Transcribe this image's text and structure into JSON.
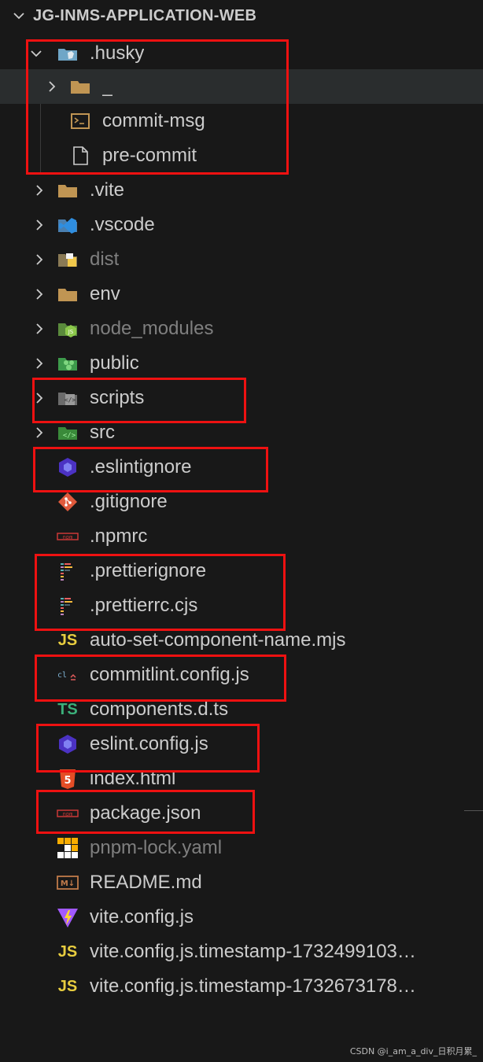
{
  "explorer": {
    "title": "JG-INMS-APPLICATION-WEB",
    "items": [
      {
        "label": ".husky",
        "kind": "folder-open",
        "icon": "husky-folder-icon"
      },
      {
        "label": "_",
        "kind": "folder-collapsed",
        "icon": "folder-icon"
      },
      {
        "label": "commit-msg",
        "kind": "file",
        "icon": "terminal-file-icon"
      },
      {
        "label": "pre-commit",
        "kind": "file",
        "icon": "file-icon"
      },
      {
        "label": ".vite",
        "kind": "folder-collapsed",
        "icon": "folder-icon"
      },
      {
        "label": ".vscode",
        "kind": "folder-collapsed",
        "icon": "vscode-folder-icon"
      },
      {
        "label": "dist",
        "kind": "folder-collapsed",
        "icon": "dist-folder-icon"
      },
      {
        "label": "env",
        "kind": "folder-collapsed",
        "icon": "folder-icon"
      },
      {
        "label": "node_modules",
        "kind": "folder-collapsed",
        "icon": "node-folder-icon"
      },
      {
        "label": "public",
        "kind": "folder-collapsed",
        "icon": "public-folder-icon"
      },
      {
        "label": "scripts",
        "kind": "folder-collapsed",
        "icon": "scripts-folder-icon"
      },
      {
        "label": "src",
        "kind": "folder-collapsed",
        "icon": "src-folder-icon"
      },
      {
        "label": ".eslintignore",
        "kind": "file",
        "icon": "eslint-icon"
      },
      {
        "label": ".gitignore",
        "kind": "file",
        "icon": "git-icon"
      },
      {
        "label": ".npmrc",
        "kind": "file",
        "icon": "npm-icon"
      },
      {
        "label": ".prettierignore",
        "kind": "file",
        "icon": "prettier-icon"
      },
      {
        "label": ".prettierrc.cjs",
        "kind": "file",
        "icon": "prettier-icon"
      },
      {
        "label": "auto-set-component-name.mjs",
        "kind": "file",
        "icon": "js-icon"
      },
      {
        "label": "commitlint.config.js",
        "kind": "file",
        "icon": "commitlint-icon"
      },
      {
        "label": "components.d.ts",
        "kind": "file",
        "icon": "ts-icon"
      },
      {
        "label": "eslint.config.js",
        "kind": "file",
        "icon": "eslint-icon"
      },
      {
        "label": "index.html",
        "kind": "file",
        "icon": "html-icon"
      },
      {
        "label": "package.json",
        "kind": "file",
        "icon": "npm-icon"
      },
      {
        "label": "pnpm-lock.yaml",
        "kind": "file",
        "icon": "pnpm-icon"
      },
      {
        "label": "README.md",
        "kind": "file",
        "icon": "markdown-icon"
      },
      {
        "label": "vite.config.js",
        "kind": "file",
        "icon": "vite-icon"
      },
      {
        "label": "vite.config.js.timestamp-1732499103…",
        "kind": "file",
        "icon": "js-icon"
      },
      {
        "label": "vite.config.js.timestamp-1732673178…",
        "kind": "file",
        "icon": "js-icon"
      }
    ]
  },
  "icon_glyphs": {
    "js": "JS",
    "ts": "TS",
    "html": "5",
    "markdown": "M↓",
    "npm": "npm",
    "commitlint": "cl"
  },
  "watermark": "CSDN @i_am_a_div_日积月累_",
  "colors": {
    "background": "#181818",
    "text": "#cccccc",
    "dim_text": "#7f7f7f",
    "selection": "#2a2d2e",
    "annotation_red": "#ee1111",
    "folder": "#c09553",
    "js": "#e8cd3f",
    "eslint": "#4b32c3",
    "vite": "#a259ff"
  }
}
